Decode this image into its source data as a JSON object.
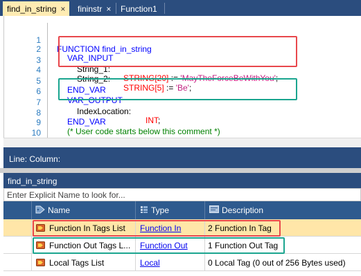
{
  "tabs": [
    {
      "label": "find_in_string",
      "active": true,
      "close": "×"
    },
    {
      "label": "fininstr",
      "active": false,
      "close": "×"
    },
    {
      "label": "Function1",
      "active": false,
      "close": ""
    }
  ],
  "code": {
    "line_numbers": [
      "1",
      "2",
      "3",
      "4",
      "5",
      "6",
      "7",
      "8",
      "9",
      "10"
    ],
    "l1": {
      "kw": "FUNCTION",
      "name": " find_in_string"
    },
    "l2": {
      "kw": "VAR_INPUT"
    },
    "l3": {
      "name": "String_1:",
      "type": "STRING[20]",
      "assign": " := ",
      "value": "'MayTheForceBeWithYou'",
      "end": ";"
    },
    "l4": {
      "name": "String_2:",
      "type": "STRING[5]",
      "assign": " := ",
      "value": "'Be'",
      "end": ";"
    },
    "l5": {
      "kw": "END_VAR"
    },
    "l6": {
      "kw": "VAR_OUTPUT"
    },
    "l7": {
      "name": "IndexLocation:",
      "type": "INT",
      "end": ";"
    },
    "l8": {
      "kw": "END_VAR"
    },
    "l9": {
      "comment": "(* User code starts below this comment *)"
    }
  },
  "status": {
    "text": "Line:  Column:"
  },
  "tags_panel": {
    "title": "find_in_string",
    "filter_placeholder": "Enter Explicit Name to look for...",
    "columns": {
      "name": "Name",
      "type": "Type",
      "description": "Description"
    },
    "rows": [
      {
        "name": "Function In Tags List",
        "type": "Function In",
        "description": "2 Function In Tag",
        "selected": true
      },
      {
        "name": "Function Out Tags L...",
        "type": "Function Out",
        "description": "1 Function Out Tag",
        "selected": false
      },
      {
        "name": "Local Tags List",
        "type": "Local",
        "description": "0 Local Tag (0 out of 256 Bytes used)",
        "selected": false
      }
    ]
  },
  "colors": {
    "keyword": "#0000ff",
    "type": "#ff0000",
    "string": "#c02080",
    "comment": "#008000",
    "line_number": "#2b7bbf",
    "highlight_red": "#e8474c",
    "highlight_teal": "#1aa58f",
    "header_blue": "#2b4d7e",
    "selected_row": "#ffe6a8"
  },
  "icons": {
    "name_column": "tag-icon",
    "type_column": "type-grid-icon",
    "description_column": "description-icon",
    "row": "tag-list-icon"
  }
}
